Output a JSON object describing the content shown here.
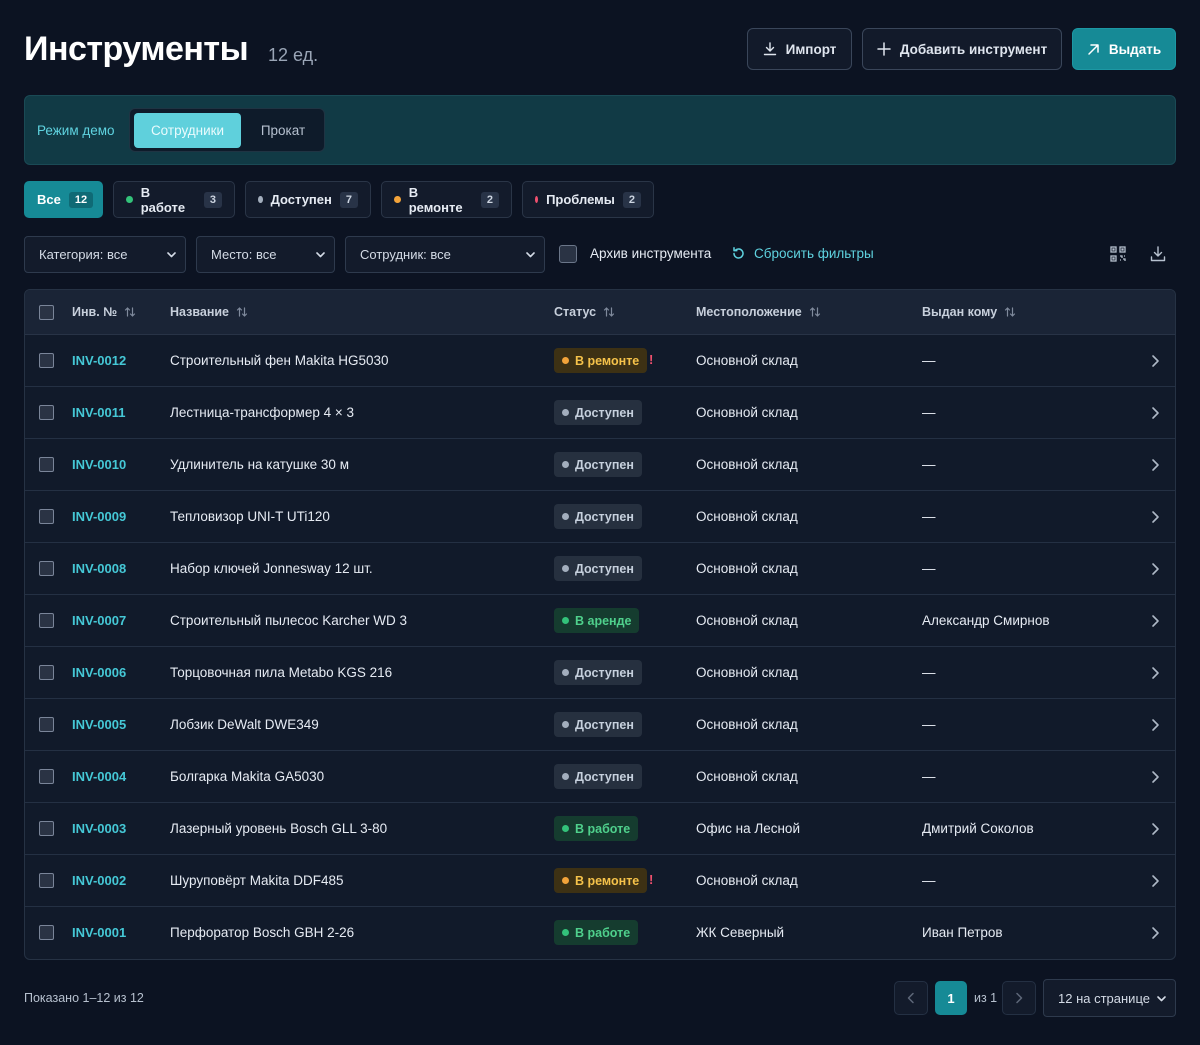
{
  "header": {
    "title": "Инструменты",
    "count": "12 ед.",
    "import_label": "Импорт",
    "add_label": "Добавить инструмент",
    "issue_label": "Выдать"
  },
  "demo": {
    "label": "Режим демо",
    "segments": [
      "Сотрудники",
      "Прокат"
    ],
    "selected": "Сотрудники"
  },
  "status_filters": [
    {
      "label": "Все",
      "count": "12",
      "active": true,
      "color": null
    },
    {
      "label": "В работе",
      "count": "3",
      "active": false,
      "color": "#33c27a"
    },
    {
      "label": "Доступен",
      "count": "7",
      "active": false,
      "color": "#a3aebd"
    },
    {
      "label": "В ремонте",
      "count": "2",
      "active": false,
      "color": "#f2a33a"
    },
    {
      "label": "Проблемы",
      "count": "2",
      "active": false,
      "color": "#f0506e"
    }
  ],
  "filters": {
    "category": "Категория: все",
    "place": "Место: все",
    "employee": "Сотрудник: все",
    "archive_label": "Архив инструмента",
    "archive_checked": false,
    "reset_label": "Сбросить фильтры"
  },
  "table": {
    "columns": [
      "Инв. №",
      "Название",
      "Статус",
      "Местоположение",
      "Выдан кому"
    ],
    "rows": [
      {
        "inv": "INV-0012",
        "name": "Строительный фен Makita HG5030",
        "status": "В ремонте",
        "kind": "repair",
        "warn": "!",
        "location": "Основной склад",
        "assignee": "—"
      },
      {
        "inv": "INV-0011",
        "name": "Лестница-трансформер 4 × 3",
        "status": "Доступен",
        "kind": "avail",
        "warn": "",
        "location": "Основной склад",
        "assignee": "—"
      },
      {
        "inv": "INV-0010",
        "name": "Удлинитель на катушке 30 м",
        "status": "Доступен",
        "kind": "avail",
        "warn": "",
        "location": "Основной склад",
        "assignee": "—"
      },
      {
        "inv": "INV-0009",
        "name": "Тепловизор UNI-T UTi120",
        "status": "Доступен",
        "kind": "avail",
        "warn": "",
        "location": "Основной склад",
        "assignee": "—"
      },
      {
        "inv": "INV-0008",
        "name": "Набор ключей Jonnesway 12 шт.",
        "status": "Доступен",
        "kind": "avail",
        "warn": "",
        "location": "Основной склад",
        "assignee": "—"
      },
      {
        "inv": "INV-0007",
        "name": "Строительный пылесос Karcher WD 3",
        "status": "В аренде",
        "kind": "rent",
        "warn": "",
        "location": "Основной склад",
        "assignee": "Александр Смирнов"
      },
      {
        "inv": "INV-0006",
        "name": "Торцовочная пила Metabo KGS 216",
        "status": "Доступен",
        "kind": "avail",
        "warn": "",
        "location": "Основной склад",
        "assignee": "—"
      },
      {
        "inv": "INV-0005",
        "name": "Лобзик DeWalt DWE349",
        "status": "Доступен",
        "kind": "avail",
        "warn": "",
        "location": "Основной склад",
        "assignee": "—"
      },
      {
        "inv": "INV-0004",
        "name": "Болгарка Makita GA5030",
        "status": "Доступен",
        "kind": "avail",
        "warn": "",
        "location": "Основной склад",
        "assignee": "—"
      },
      {
        "inv": "INV-0003",
        "name": "Лазерный уровень Bosch GLL 3-80",
        "status": "В работе",
        "kind": "work",
        "warn": "",
        "location": "Офис на Лесной",
        "assignee": "Дмитрий Соколов"
      },
      {
        "inv": "INV-0002",
        "name": "Шуруповёрт Makita DDF485",
        "status": "В ремонте",
        "kind": "repair",
        "warn": "!",
        "location": "Основной склад",
        "assignee": "—"
      },
      {
        "inv": "INV-0001",
        "name": "Перфоратор Bosch GBH 2-26",
        "status": "В работе",
        "kind": "work",
        "warn": "",
        "location": "ЖК Северный",
        "assignee": "Иван Петров"
      }
    ]
  },
  "footer": {
    "shown": "Показано 1–12 из 12",
    "page": "1",
    "of": "из 1",
    "per_page": "12 на странице"
  }
}
